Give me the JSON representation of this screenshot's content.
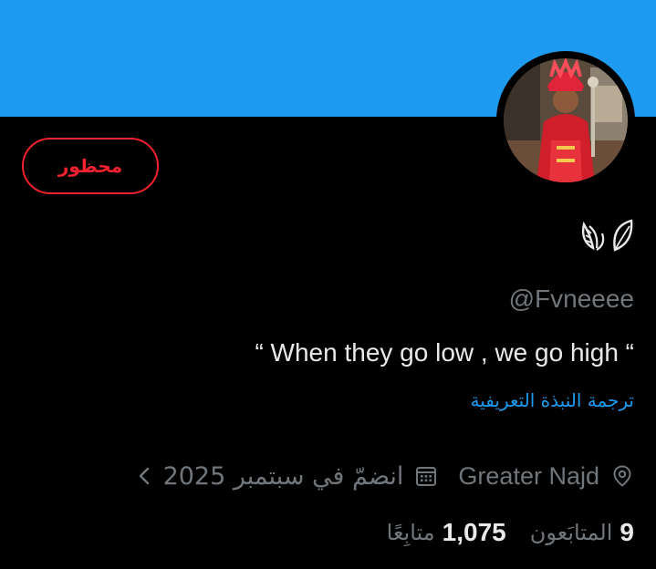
{
  "profile": {
    "blocked_label": "محظور",
    "handle": "@Fvneeee",
    "bio": "“ When they go low , we go high “",
    "translate_bio_label": "ترجمة النبذة التعريفية",
    "location": "Greater Najd",
    "joined": "انضمّ في سبتمبر 2025",
    "followers_count": "9",
    "followers_label": "المتابَعون",
    "following_count": "1,075",
    "following_label": "متابِعًا",
    "name_emoji": "leaves-emoji"
  },
  "colors": {
    "banner": "#1d9bf0",
    "background": "#000000",
    "blocked": "#f4212e",
    "link": "#1d9bf0",
    "secondary_text": "#71767b",
    "primary_text": "#e7e9ea"
  },
  "icons": [
    "location-pin-icon",
    "calendar-icon",
    "chevron-left-icon",
    "leaves-emoji"
  ]
}
